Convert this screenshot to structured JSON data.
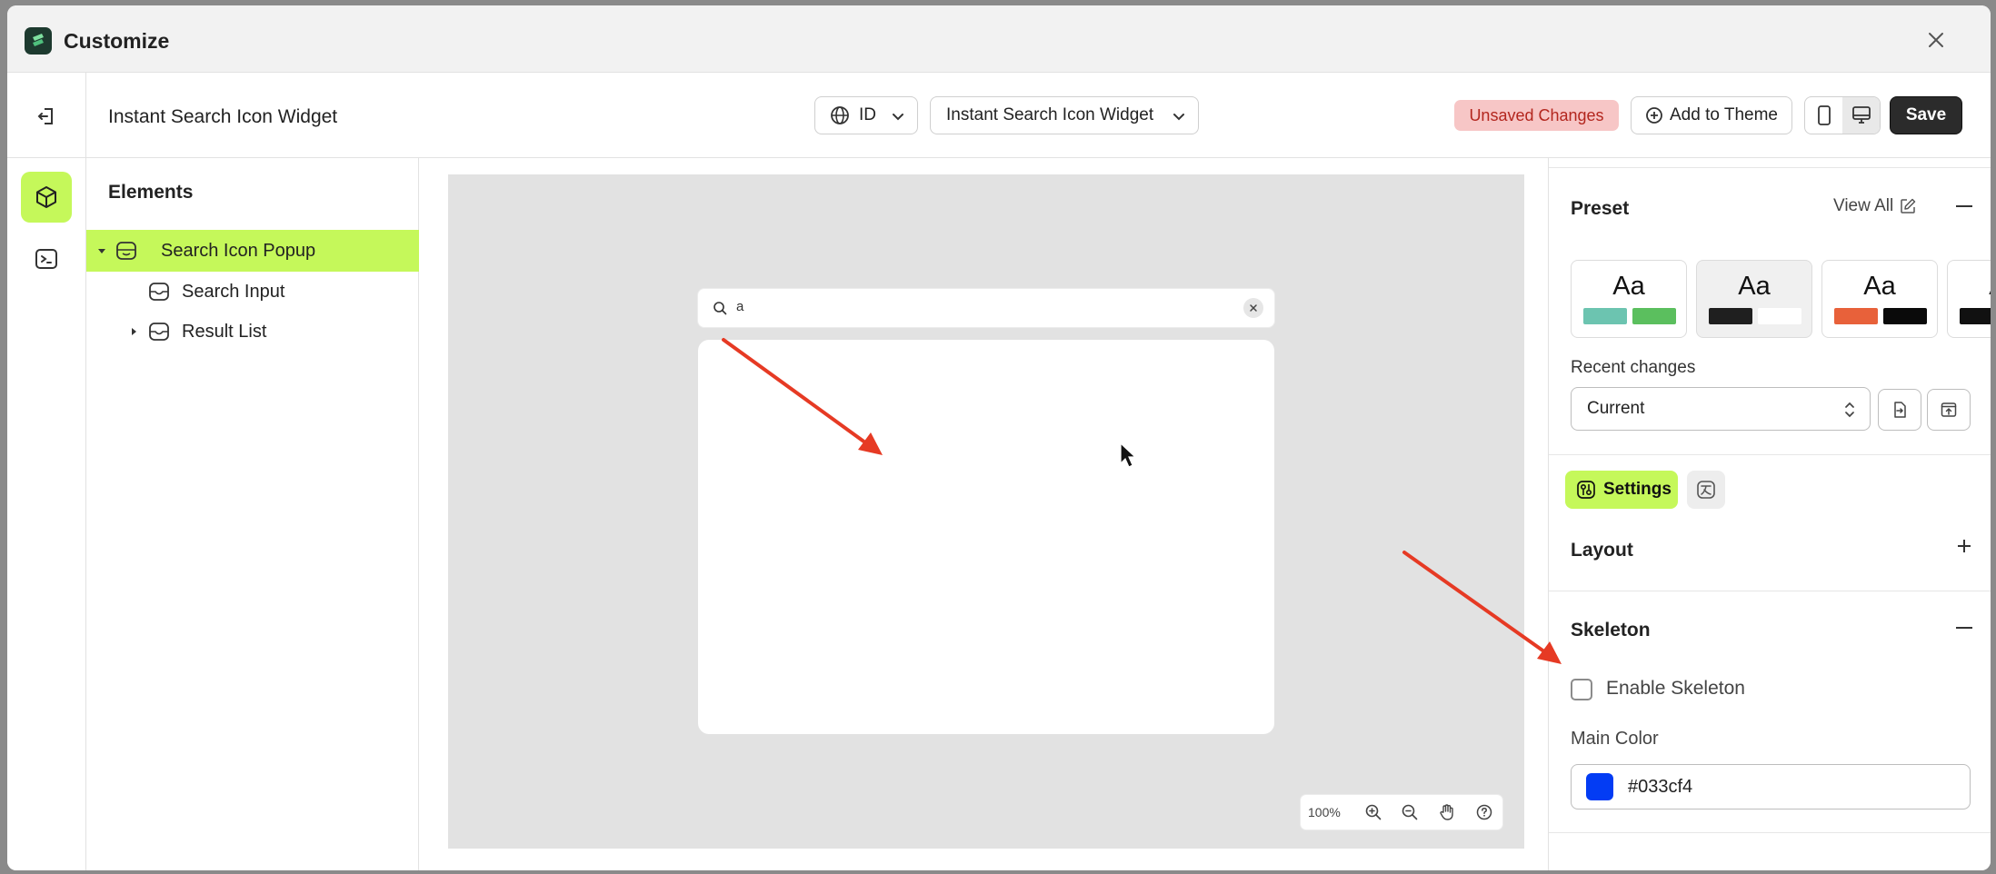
{
  "app": {
    "title": "Customize",
    "close_label": "Close"
  },
  "toolbar": {
    "widget_title": "Instant Search Icon Widget",
    "language": "ID",
    "template": "Instant Search Icon Widget",
    "status": "Unsaved Changes",
    "add_to_theme": "Add to Theme",
    "save": "Save"
  },
  "elements": {
    "title": "Elements",
    "items": [
      {
        "label": "Search Icon Popup",
        "selected": true,
        "expanded": true
      },
      {
        "label": "Search Input",
        "selected": false
      },
      {
        "label": "Result List",
        "selected": false,
        "expanded": false
      }
    ]
  },
  "canvas": {
    "search_value": "a",
    "zoom": "100%"
  },
  "right_panel": {
    "preset": {
      "title": "Preset",
      "view_all": "View All",
      "cards": [
        {
          "label": "Aa",
          "colors": [
            "#6cc4b0",
            "#5bbf5e"
          ]
        },
        {
          "label": "Aa",
          "colors": [
            "#1f1f1f",
            "#ffffff"
          ]
        },
        {
          "label": "Aa",
          "colors": [
            "#e8613a",
            "#0a0a0a"
          ]
        },
        {
          "label": "Aa",
          "colors": [
            "#111111"
          ]
        }
      ]
    },
    "recent_changes": {
      "label": "Recent changes",
      "value": "Current"
    },
    "tabs": {
      "settings": "Settings"
    },
    "layout": {
      "title": "Layout"
    },
    "skeleton": {
      "title": "Skeleton",
      "enable_label": "Enable Skeleton",
      "enabled": false,
      "main_color_label": "Main Color",
      "main_color": "#033cf4"
    }
  },
  "colors": {
    "accent": "#c5f85a",
    "unsaved_bg": "#f7c6c6",
    "unsaved_text": "#b3261e",
    "annotation_arrow": "#e63a24"
  }
}
